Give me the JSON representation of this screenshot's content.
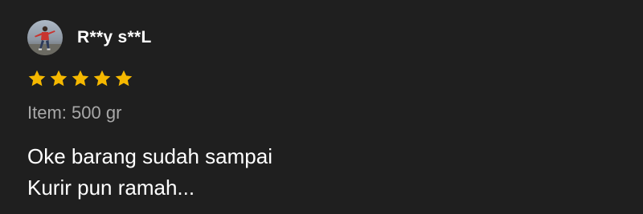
{
  "review": {
    "username": "R**y s**L",
    "rating": 5,
    "star_color": "#f5b800",
    "variant": "Item: 500 gr",
    "comment_lines": [
      "Oke barang sudah sampai",
      "Kurir pun ramah..."
    ]
  },
  "icons": {
    "avatar": "user-avatar-photo",
    "star": "star-icon"
  }
}
